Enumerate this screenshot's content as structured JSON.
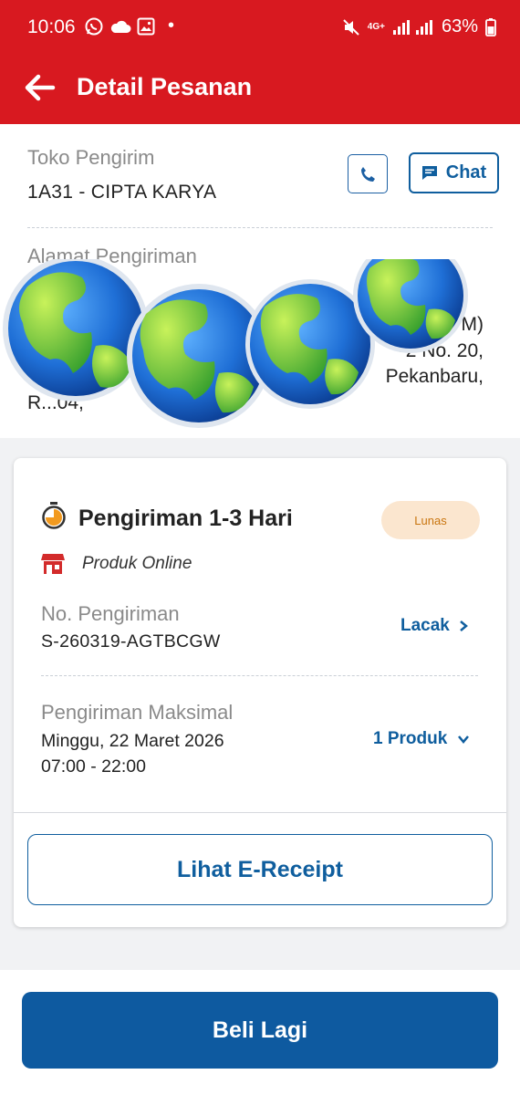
{
  "status_bar": {
    "time": "10:06",
    "dot": "•",
    "network": "4G+",
    "battery": "63%",
    "icons": [
      "whatsapp-icon",
      "cloud-icon",
      "image-icon",
      "mute-icon",
      "signal-icon",
      "battery-icon"
    ]
  },
  "app_bar": {
    "title": "Detail Pesanan",
    "back_icon": "arrow-left-icon"
  },
  "store": {
    "label": "Toko Pengirim",
    "name": "1A31 - CIPTA KARYA",
    "chat_label": "Chat",
    "address_label": "Alamat Pengiriman",
    "address_lines": [
      "M)",
      "-2 No. 20,",
      "Pekanbaru,",
      "R...04,"
    ]
  },
  "shipment": {
    "title": "Pengiriman 1-3 Hari",
    "status_badge": "Lunas",
    "channel": "Produk Online",
    "number_label": "No. Pengiriman",
    "number_value": "S-260319-AGTBCGW",
    "track_label": "Lacak",
    "max_label": "Pengiriman Maksimal",
    "max_date": "Minggu, 22 Maret 2026",
    "max_time": "07:00 - 22:00",
    "products_label": "1 Produk",
    "receipt_button": "Lihat E-Receipt"
  },
  "footer": {
    "buy_again": "Beli Lagi"
  },
  "colors": {
    "header_red": "#d81920",
    "primary_blue": "#0e5aa0",
    "badge_bg": "#fbe6cf",
    "badge_text": "#c9750f",
    "store_icon_red": "#d32b2b",
    "timer_orange": "#f29a1f"
  }
}
